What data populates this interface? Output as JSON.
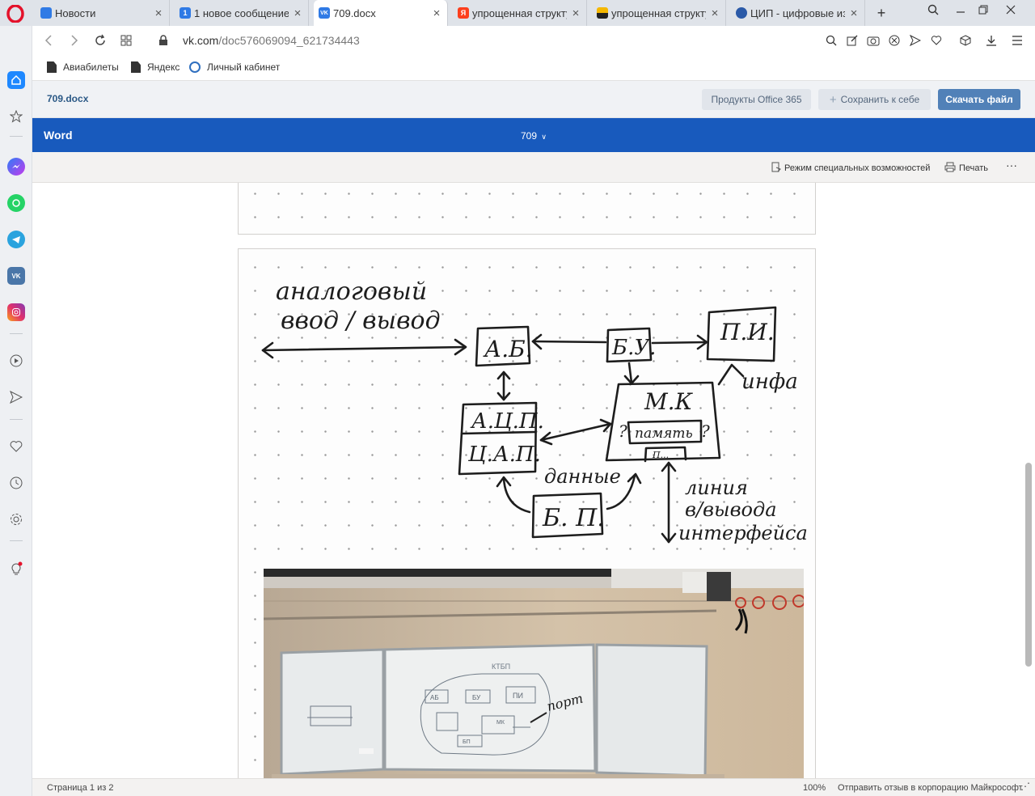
{
  "browser": {
    "tabs": [
      {
        "title": "Новости",
        "favicon": "vk-messenger-icon",
        "color": "#2f7ae5",
        "glyph": ""
      },
      {
        "title": "1 новое сообщение",
        "favicon": "vk-badge-icon",
        "color": "#2f7ae5",
        "glyph": "1"
      },
      {
        "title": "709.docx",
        "favicon": "vk-icon",
        "color": "#2f7ae5",
        "glyph": "VK"
      },
      {
        "title": "упрощенная структур",
        "favicon": "yandex-icon",
        "color": "#fc3f1d",
        "glyph": "Я"
      },
      {
        "title": "упрощенная структур",
        "favicon": "yandex-images-icon",
        "color": "#222222",
        "glyph": ""
      },
      {
        "title": "ЦИП - цифровые изм",
        "favicon": "site-icon",
        "color": "#2b5aa8",
        "glyph": ""
      }
    ],
    "url_host": "vk.com",
    "url_path": "/doc576069094_621734443",
    "bookmarks": [
      "Авиабилеты",
      "Яндекс",
      "Личный кабинет"
    ]
  },
  "sidebar": {
    "items": [
      "home-icon",
      "star-icon",
      "messenger-icon",
      "whatsapp-icon",
      "telegram-icon",
      "vk-icon",
      "instagram-icon",
      "player-icon",
      "send-icon",
      "heart-icon",
      "history-icon",
      "settings-icon",
      "tips-icon"
    ]
  },
  "vk_doc": {
    "filename": "709.docx",
    "btn_office": "Продукты Office 365",
    "btn_save": "Сохранить к себе",
    "btn_download": "Скачать файл"
  },
  "word": {
    "brand": "Word",
    "file_title": "709",
    "accessibility": "Режим специальных возможностей",
    "print": "Печать",
    "more": "···"
  },
  "sketch": {
    "analog_line1": "аналоговый",
    "analog_line2": "ввод / вывод",
    "ab": "А.Б.",
    "bu": "Б.У.",
    "pi": "П.И.",
    "info": "инфа",
    "mk": "М.К",
    "memory": "память",
    "p_small": "П...",
    "q": "?",
    "adc": "А.Ц.П.",
    "dac": "Ц.А.П.",
    "data_label": "данные",
    "bp": "Б. П.",
    "line_l1": "линия",
    "line_l2": "в/вывода",
    "line_l3": "интерфейса"
  },
  "photo": {
    "board_title": "КТБП",
    "port_label": "порт",
    "ab": "АБ",
    "bu": "БУ",
    "pi": "ПИ",
    "mk": "МК",
    "bp": "БП"
  },
  "status": {
    "page": "Страница 1 из 2",
    "zoom": "100%",
    "feedback": "Отправить отзыв в корпорацию Майкрософт"
  }
}
